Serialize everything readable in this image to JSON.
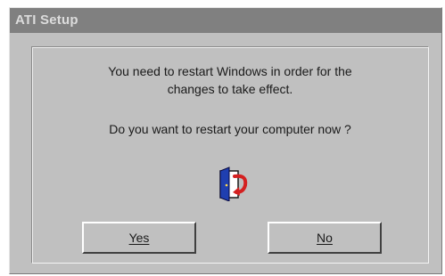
{
  "window": {
    "title": "ATI Setup"
  },
  "message": {
    "line1": "You need to restart Windows in order for the",
    "line2": "changes to take effect.",
    "question": "Do you want to restart your computer now ?"
  },
  "icon": {
    "name": "restart-door-icon"
  },
  "buttons": {
    "yes_label": "Yes",
    "no_label": "No"
  },
  "colors": {
    "titlebar": "#808080",
    "dialog_face": "#c0c0c0",
    "door_blue": "#1f3fb0",
    "arrow_red": "#d42020"
  }
}
